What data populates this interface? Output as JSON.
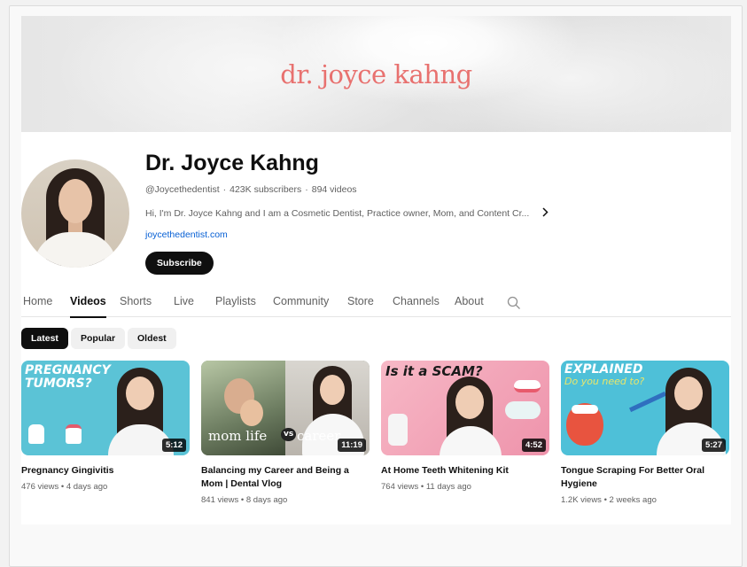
{
  "banner": {
    "text": "dr. joyce kahng"
  },
  "channel": {
    "name": "Dr. Joyce Kahng",
    "handle": "@Joycethedentist",
    "subscribers": "423K subscribers",
    "videos": "894 videos",
    "separator": "·",
    "description": "Hi, I'm Dr. Joyce Kahng and I am a Cosmetic Dentist, Practice owner, Mom, and Content Cr...",
    "description_more_icon": "chevron-right-icon",
    "link": "joycethedentist.com",
    "subscribe_label": "Subscribe"
  },
  "tabs": [
    {
      "label": "Home",
      "active": false
    },
    {
      "label": "Videos",
      "active": true
    },
    {
      "label": "Shorts",
      "active": false
    },
    {
      "label": "Live",
      "active": false
    },
    {
      "label": "Playlists",
      "active": false
    },
    {
      "label": "Community",
      "active": false
    },
    {
      "label": "Store",
      "active": false
    },
    {
      "label": "Channels",
      "active": false
    },
    {
      "label": "About",
      "active": false
    }
  ],
  "search_icon": "search-icon",
  "chips": [
    {
      "label": "Latest",
      "active": true
    },
    {
      "label": "Popular",
      "active": false
    },
    {
      "label": "Oldest",
      "active": false
    }
  ],
  "videos": [
    {
      "title": "Pregnancy Gingivitis",
      "meta": "476 views • 4 days ago",
      "duration": "5:12",
      "thumb_text": [
        "PREGNANCY",
        "TUMORS?"
      ],
      "thumb_color": "#5bc3d6"
    },
    {
      "title": "Balancing my Career and Being a Mom | Dental Vlog",
      "meta": "841 views • 8 days ago",
      "duration": "11:19",
      "thumb_text": [
        "mom life",
        "vs",
        "career"
      ],
      "thumb_color": "#6f7a6a"
    },
    {
      "title": "At Home Teeth Whitening Kit",
      "meta": "764 views • 11 days ago",
      "duration": "4:52",
      "thumb_text": [
        "Is it a SCAM?"
      ],
      "thumb_color": "#f2a3b6"
    },
    {
      "title": "Tongue Scraping For Better Oral Hygiene",
      "meta": "1.2K views • 2 weeks ago",
      "duration": "5:27",
      "thumb_text": [
        "EXPLAINED",
        "Do you need to?"
      ],
      "thumb_color": "#4ec0d8"
    }
  ],
  "colors": {
    "banner_text": "#e8716f",
    "link": "#065fd4",
    "subscribe_bg": "#0f0f0f"
  }
}
